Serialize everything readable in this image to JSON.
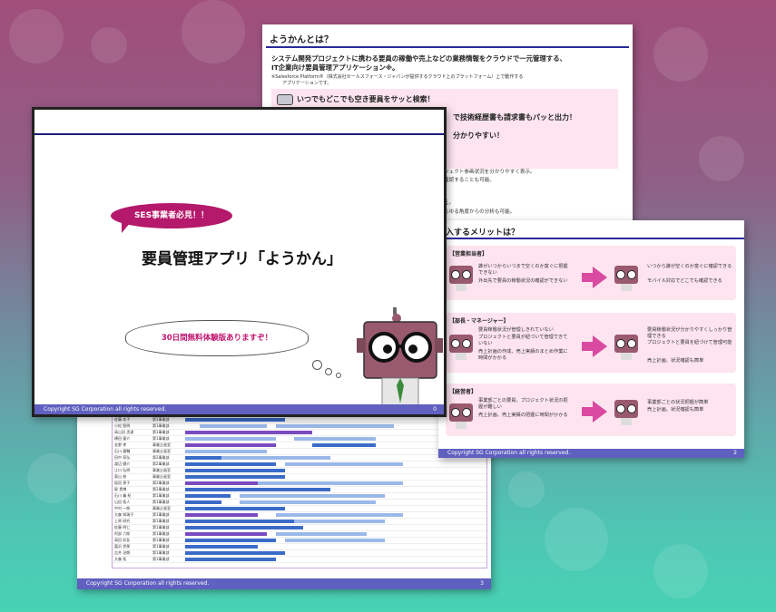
{
  "slide_top": {
    "heading": "ようかんとは？",
    "intro_line1": "システム開発プロジェクトに携わる要員の稼働や売上などの業務情報をクラウドで一元管理する、",
    "intro_line2": "IT企業向け要員管理アプリケーション※。",
    "note_line1": "※Salesforce Platform®（株式会社セールスフォース・ジャパンが提供するクラウド上のプラットフォーム）上で動作する",
    "note_line2": "アプリケーションです。",
    "point1": "いつでもどこでも空き要員をサッと検索！",
    "point2": "で技術経歴書も請求書もパッと出力！",
    "point3": "分かりやすい！",
    "text1": "ジェクト参画状況を分かりやすく表示。",
    "text2": "確認することも可能。",
    "text3": "え。",
    "text4": "らゆる角度からの分析も可能。"
  },
  "slide_right": {
    "heading": "入するメリットは？",
    "sections": [
      {
        "label": "【営業担当者】",
        "before": [
          "誰がいつからいつまで空くのか富ぐに把握できない",
          "外出先で要員の稼働状況の確認ができない"
        ],
        "after": [
          "いつから誰が空くのか富ぐに確認できる",
          "モバイル対応でどこでも確認できる"
        ]
      },
      {
        "label": "【部長・マネージャー】",
        "before": [
          "要員稼働状況が管理しきれていない",
          "プロジェクトと要員が紐づいて管理できていない",
          "売上計画の作成、売上実績のまとめ作業に時間がかかる"
        ],
        "after": [
          "要員稼働状況が分かりやすくしっかり管理できる",
          "プロジェクトと要員を紐づけて管理可能",
          "売上計画、状況確認も簡単"
        ]
      },
      {
        "label": "【経営者】",
        "before": [
          "事業部ごとの要員、プロジェクト状況の把握が難しい",
          "売上計画、売上実績の把握に時間がかかる"
        ],
        "after": [
          "事業部ごとの状況把握が簡単",
          "売上計画、状況確認も簡単"
        ]
      }
    ],
    "footer": "Copyright SG Corporation all rights reserved.",
    "page": "2"
  },
  "slide_bottom": {
    "footer": "Copyright SG Corporation all rights reserved.",
    "page": "3",
    "rows": [
      {
        "name": "佐藤 花子",
        "dept": "第1事業部"
      },
      {
        "name": "小松 智明",
        "dept": "第1事業部"
      },
      {
        "name": "高山田 丞達",
        "dept": "第1事業部"
      },
      {
        "name": "横田 憲介",
        "dept": "第1事業部"
      },
      {
        "name": "金野 孝",
        "dept": "事業企画室"
      },
      {
        "name": "石川 健輔",
        "dept": "事業企画室"
      },
      {
        "name": "田中 寿弘",
        "dept": "第2事業部"
      },
      {
        "name": "渡辺 健介",
        "dept": "第2事業部"
      },
      {
        "name": "江口 弘明",
        "dept": "事業企画室"
      },
      {
        "name": "東山 修",
        "dept": "事業企画室"
      },
      {
        "name": "坂田 恵子",
        "dept": "第2事業部"
      },
      {
        "name": "星 貴博",
        "dept": "第2事業部"
      },
      {
        "name": "石川 義 紀",
        "dept": "第1事業部"
      },
      {
        "name": "山田 拓人",
        "dept": "第1事業部"
      },
      {
        "name": "中村 一郎",
        "dept": "事業企画室"
      },
      {
        "name": "大森 知瑞子",
        "dept": "第1事業部"
      },
      {
        "name": "上原 研究",
        "dept": "第1事業部"
      },
      {
        "name": "佐藤 明仁",
        "dept": "第1事業部"
      },
      {
        "name": "阿部 六郎",
        "dept": "第1事業部"
      },
      {
        "name": "高田 彩女",
        "dept": "第1事業部"
      },
      {
        "name": "富沢 伊那",
        "dept": "第1事業部"
      },
      {
        "name": "吉井 治朗",
        "dept": "第1事業部"
      },
      {
        "name": "大森 拓",
        "dept": "第1事業部"
      }
    ]
  },
  "slide_main": {
    "bubble": "SES事業者必見！！",
    "title": "要員管理アプリ「ようかん」",
    "cloud": "30日間無料体験版ありますぞ！",
    "footer": "Copyright SG Corporation all rights reserved.",
    "page": "0"
  },
  "colors": {
    "accent_pink": "#b5196b",
    "bar_blue": "#3a6bc8",
    "bar_light": "#9ab8e8",
    "bar_purple": "#7a4ac0",
    "footer": "#6060c0"
  }
}
